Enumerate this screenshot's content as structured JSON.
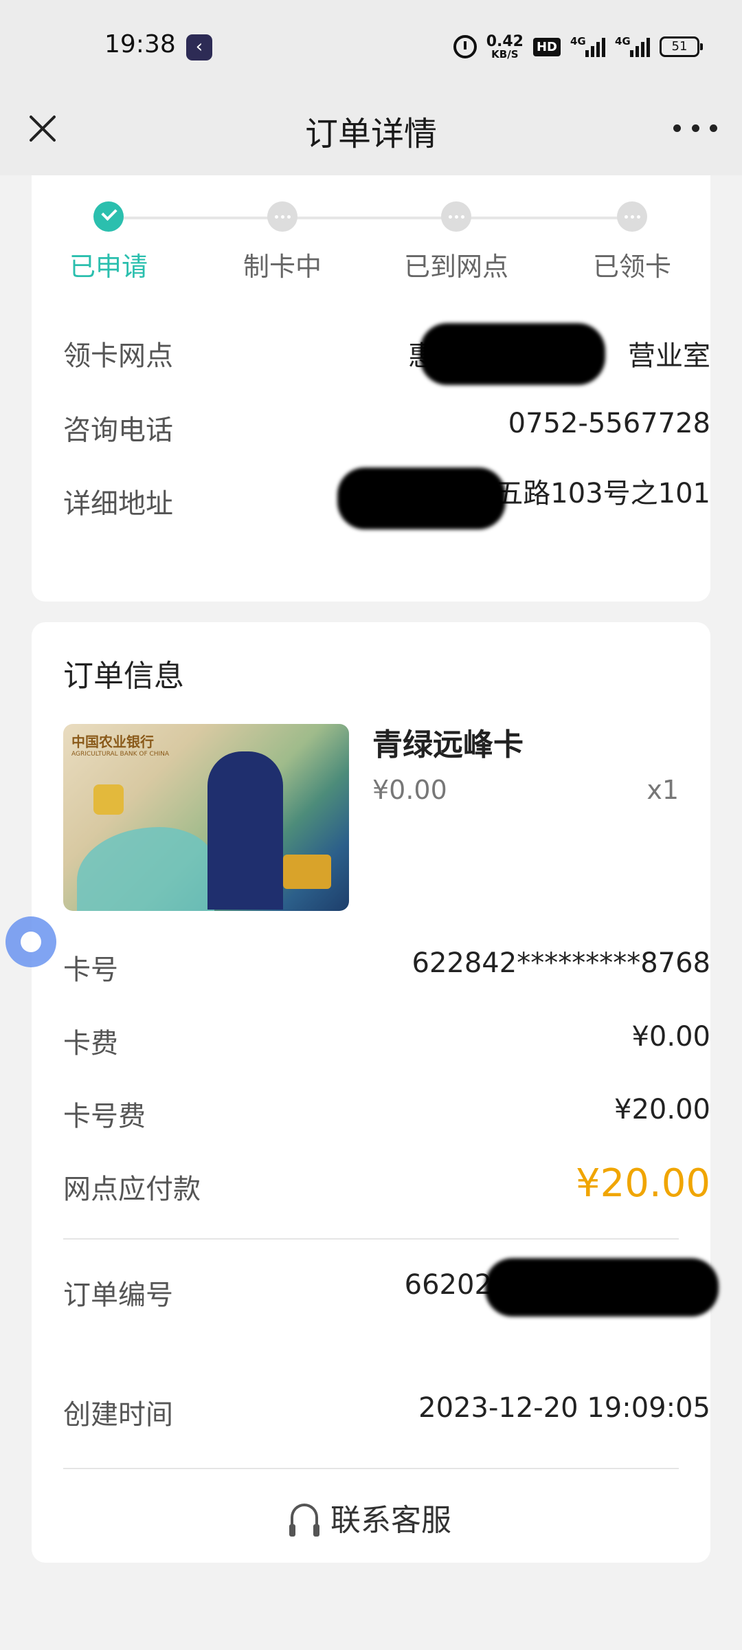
{
  "status_bar": {
    "time": "19:38",
    "net_speed": "0.42",
    "net_unit": "KB/S",
    "hd_label": "HD",
    "signal1_label": "4G",
    "signal2_label": "4G",
    "battery": "51"
  },
  "header": {
    "title": "订单详情"
  },
  "progress": {
    "steps": [
      "已申请",
      "制卡中",
      "已到网点",
      "已领卡"
    ],
    "active_index": 0
  },
  "pickup": {
    "branch_label": "领卡网点",
    "branch_value_prefix": "惠州",
    "branch_value_suffix": "营业室",
    "phone_label": "咨询电话",
    "phone_value": "0752-5567728",
    "address_label": "详细地址",
    "address_value": "惠州          五路103号之101"
  },
  "order": {
    "section_title": "订单信息",
    "product_name": "青绿远峰卡",
    "product_price": "¥0.00",
    "product_qty": "x1",
    "card_bank_name": "中国农业银行",
    "card_bank_name_en": "AGRICULTURAL BANK OF CHINA",
    "card_no_label": "卡号",
    "card_no_value": "622842*********8768",
    "card_fee_label": "卡费",
    "card_fee_value": "¥0.00",
    "number_fee_label": "卡号费",
    "number_fee_value": "¥20.00",
    "pay_label": "网点应付款",
    "pay_value": "¥20.00",
    "order_no_label": "订单编号",
    "order_no_value": "66202312201909          299",
    "created_label": "创建时间",
    "created_value": "2023-12-20 19:09:05",
    "service_label": "联系客服"
  },
  "colors": {
    "accent": "#2bbfae",
    "amount": "#f0a500",
    "floating_ball": "#6b95f0"
  }
}
